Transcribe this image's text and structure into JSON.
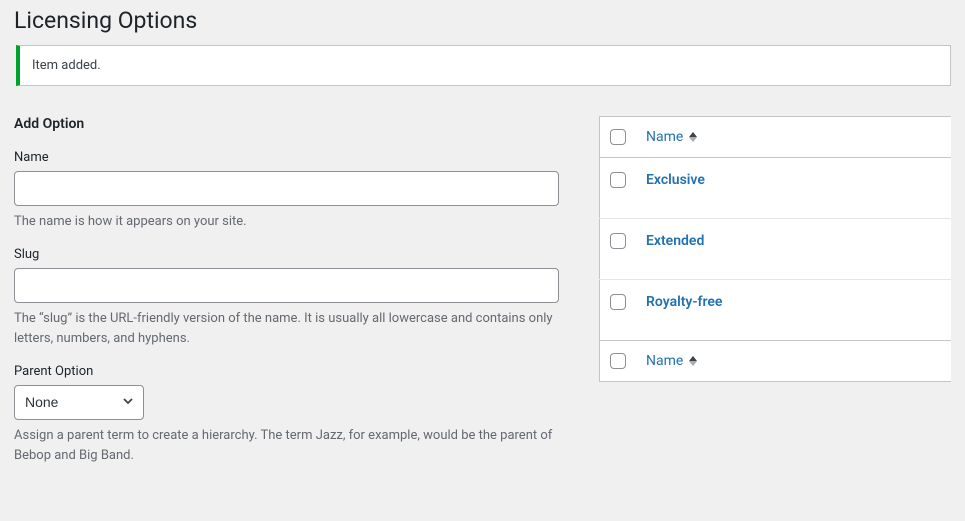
{
  "page": {
    "title": "Licensing Options",
    "notice": "Item added."
  },
  "form": {
    "heading": "Add Option",
    "name": {
      "label": "Name",
      "value": "",
      "desc": "The name is how it appears on your site."
    },
    "slug": {
      "label": "Slug",
      "value": "",
      "desc": "The “slug” is the URL-friendly version of the name. It is usually all lowercase and contains only letters, numbers, and hyphens."
    },
    "parent": {
      "label": "Parent Option",
      "selected": "None",
      "desc": "Assign a parent term to create a hierarchy. The term Jazz, for example, would be the parent of Bebop and Big Band."
    }
  },
  "table": {
    "columns": {
      "name": "Name"
    },
    "rows": [
      {
        "name": "Exclusive"
      },
      {
        "name": "Extended"
      },
      {
        "name": "Royalty-free"
      }
    ]
  }
}
